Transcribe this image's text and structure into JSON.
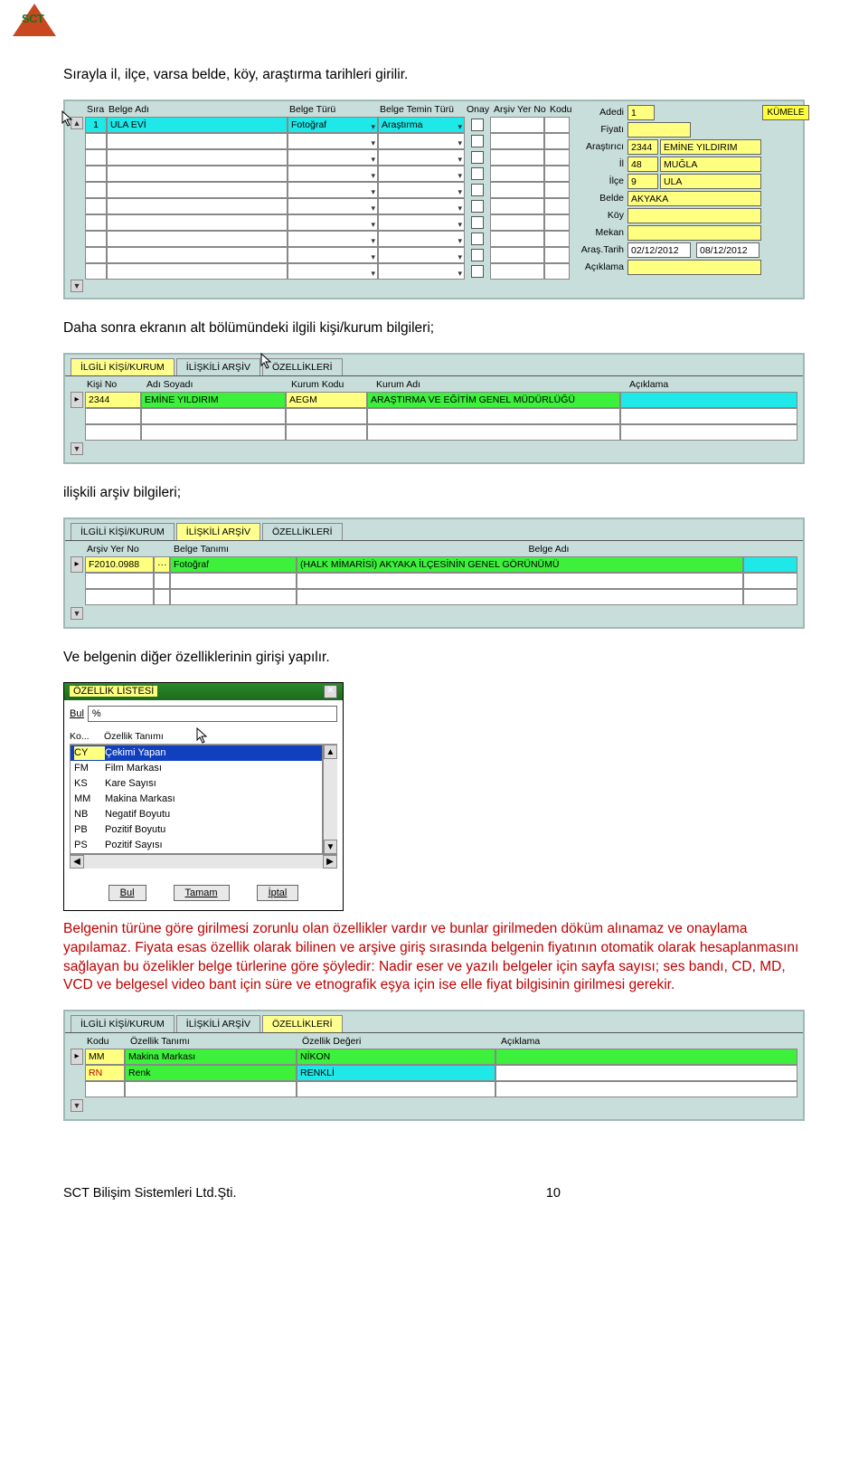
{
  "intro_text": "Sırayla il, ilçe, varsa belde, köy, araştırma tarihleri girilir.",
  "grid1": {
    "headers": {
      "sira": "Sıra",
      "belge_adi": "Belge Adı",
      "belge_turu": "Belge Türü",
      "temin": "Belge Temin Türü",
      "onay": "Onay",
      "arsiv": "Arşiv Yer No",
      "kodu": "Kodu"
    },
    "row": {
      "sira": "1",
      "belge_adi": "ULA EVİ",
      "belge_turu": "Fotoğraf",
      "temin": "Araştırma"
    },
    "form": {
      "adedi_l": "Adedi",
      "adedi_v": "1",
      "kumele": "KÜMELE",
      "fiyati_l": "Fiyatı",
      "arastirici_l": "Araştırıcı",
      "arastirici_k": "2344",
      "arastirici_n": "EMİNE  YILDIRIM",
      "il_l": "İl",
      "il_k": "48",
      "il_n": "MUĞLA",
      "ilce_l": "İlçe",
      "ilce_k": "9",
      "ilce_n": "ULA",
      "belde_l": "Belde",
      "belde_v": "AKYAKA",
      "koy_l": "Köy",
      "mekan_l": "Mekan",
      "tarih_l": "Araş.Tarih",
      "tarih1": "02/12/2012",
      "tarih2": "08/12/2012",
      "aciklama_l": "Açıklama"
    }
  },
  "text2": "Daha sonra ekranın alt bölümündeki ilgili kişi/kurum bilgileri;",
  "tabs": {
    "t1": "İLGİLİ KİŞİ/KURUM",
    "t2": "İLİŞKİLİ ARŞİV",
    "t3": "ÖZELLİKLERİ"
  },
  "panel2": {
    "h": {
      "kno": "Kişi No",
      "ad": "Adı Soyadı",
      "kkod": "Kurum Kodu",
      "kadi": "Kurum Adı",
      "acik": "Açıklama"
    },
    "r": {
      "kno": "2344",
      "ad": "EMİNE  YILDIRIM",
      "kkod": "AEGM",
      "kadi": "ARAŞTIRMA VE EĞİTİM GENEL MÜDÜRLÜĞÜ"
    }
  },
  "text3": "ilişkili arşiv bilgileri;",
  "panel3": {
    "h": {
      "ayno": "Arşiv Yer No",
      "btan": "Belge Tanımı",
      "bad": "Belge Adı"
    },
    "r": {
      "ayno": "F2010.0988",
      "dots": "···",
      "btan": "Fotoğraf",
      "bad": "(HALK MİMARİSİ) AKYAKA İLÇESİNİN GENEL GÖRÜNÜMÜ"
    }
  },
  "text4": "Ve belgenin diğer özelliklerinin girişi yapılır.",
  "listbox": {
    "title": "ÖZELLİK LİSTESİ",
    "bul_l": "Bul",
    "bul_v": "%",
    "h1": "Ko...",
    "h2": "Özellik Tanımı",
    "rows": [
      {
        "k": "CY",
        "t": "Çekimi Yapan",
        "sel": true
      },
      {
        "k": "FM",
        "t": "Film Markası"
      },
      {
        "k": "KS",
        "t": "Kare Sayısı"
      },
      {
        "k": "MM",
        "t": "Makina Markası"
      },
      {
        "k": "NB",
        "t": "Negatif Boyutu"
      },
      {
        "k": "PB",
        "t": "Pozitif Boyutu"
      },
      {
        "k": "PS",
        "t": "Pozitif Sayısı"
      }
    ],
    "btn_bul": "Bul",
    "btn_tamam": "Tamam",
    "btn_iptal": "İptal"
  },
  "text5": "Belgenin türüne göre girilmesi zorunlu olan özellikler vardır ve bunlar girilmeden döküm alınamaz ve onaylama yapılamaz. Fiyata esas özellik olarak bilinen ve arşive giriş sırasında belgenin fiyatının otomatik olarak hesaplanmasını sağlayan bu özelikler belge türlerine göre şöyledir: Nadir eser ve yazılı belgeler için sayfa sayısı; ses bandı, CD, MD, VCD ve belgesel video bant için süre ve etnografik eşya için ise elle fiyat bilgisinin girilmesi gerekir.",
  "panel4": {
    "h": {
      "kodu": "Kodu",
      "ot": "Özellik Tanımı",
      "od": "Özellik Değeri",
      "ac": "Açıklama"
    },
    "r1": {
      "kodu": "MM",
      "ot": "Makina Markası",
      "od": "NİKON"
    },
    "r2": {
      "kodu": "RN",
      "ot": "Renk",
      "od": "RENKLİ"
    }
  },
  "footer": {
    "company": "SCT Bilişim Sistemleri Ltd.Şti.",
    "page": "10"
  }
}
